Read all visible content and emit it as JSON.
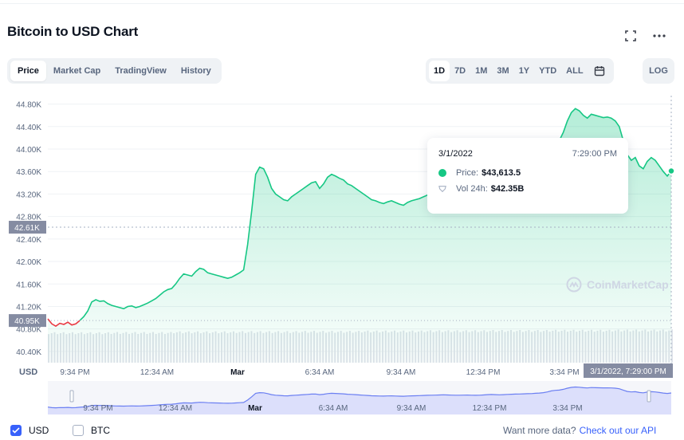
{
  "header": {
    "title": "Bitcoin to USD Chart",
    "fullscreen_icon": "fullscreen-icon",
    "more_icon": "more-horizontal-icon"
  },
  "tabs": [
    {
      "label": "Price",
      "active": true
    },
    {
      "label": "Market Cap",
      "active": false
    },
    {
      "label": "TradingView",
      "active": false
    },
    {
      "label": "History",
      "active": false
    }
  ],
  "ranges": [
    {
      "label": "1D",
      "active": true
    },
    {
      "label": "7D",
      "active": false
    },
    {
      "label": "1M",
      "active": false
    },
    {
      "label": "3M",
      "active": false
    },
    {
      "label": "1Y",
      "active": false
    },
    {
      "label": "YTD",
      "active": false
    },
    {
      "label": "ALL",
      "active": false
    }
  ],
  "log_label": "LOG",
  "tooltip": {
    "date": "3/1/2022",
    "time": "7:29:00 PM",
    "price_label": "Price:",
    "price_value": "$43,613.5",
    "vol_label": "Vol 24h:",
    "vol_value": "$42.35B"
  },
  "watermark": "CoinMarketCap",
  "chart_data": {
    "type": "line",
    "y_ticks": [
      "44.80K",
      "44.40K",
      "44.00K",
      "43.60K",
      "43.20K",
      "42.80K",
      "42.40K",
      "42.00K",
      "41.60K",
      "41.20K",
      "40.80K",
      "40.40K"
    ],
    "y_tick_values": [
      44800,
      44400,
      44000,
      43600,
      43200,
      42800,
      42400,
      42000,
      41600,
      41200,
      40800,
      40400
    ],
    "ylim": [
      40200,
      44950
    ],
    "y_axis_unit": "USD",
    "x_ticks": [
      "9:34 PM",
      "12:34 AM",
      "Mar",
      "6:34 AM",
      "9:34 AM",
      "12:34 PM",
      "3:34 PM"
    ],
    "x_tick_positions_fraction": [
      0.0,
      0.12
    ],
    "crosshair_y_label": "42.61K",
    "crosshair_y_value": 42610,
    "open_label": "40.95K",
    "open_value": 40950,
    "crosshair_x_label": "3/1/2022, 7:29:00 PM",
    "price": [
      40980,
      40890,
      40850,
      40900,
      40880,
      40920,
      40870,
      40890,
      40950,
      41020,
      41120,
      41280,
      41320,
      41290,
      41300,
      41250,
      41220,
      41200,
      41180,
      41160,
      41200,
      41210,
      41180,
      41200,
      41230,
      41260,
      41300,
      41340,
      41400,
      41460,
      41500,
      41520,
      41600,
      41700,
      41780,
      41760,
      41740,
      41820,
      41880,
      41860,
      41800,
      41780,
      41760,
      41740,
      41720,
      41700,
      41720,
      41760,
      41800,
      41850,
      42300,
      42900,
      43550,
      43680,
      43650,
      43500,
      43300,
      43200,
      43150,
      43100,
      43080,
      43150,
      43200,
      43250,
      43300,
      43350,
      43400,
      43420,
      43300,
      43380,
      43500,
      43550,
      43520,
      43480,
      43450,
      43380,
      43350,
      43300,
      43250,
      43200,
      43150,
      43100,
      43080,
      43050,
      43030,
      43060,
      43080,
      43050,
      43020,
      43000,
      43050,
      43080,
      43100,
      43120,
      43150,
      43180,
      43200,
      43220,
      43250,
      43280,
      43250,
      43220,
      43200,
      43200,
      43220,
      43230,
      43200,
      43180,
      43200,
      43250,
      43300,
      43330,
      43300,
      43280,
      43300,
      43350,
      43380,
      43400,
      43420,
      43450,
      43480,
      43500,
      43550,
      43600,
      43680,
      43800,
      44000,
      44100,
      44150,
      44300,
      44500,
      44650,
      44720,
      44680,
      44600,
      44550,
      44620,
      44600,
      44580,
      44560,
      44570,
      44550,
      44500,
      44400,
      44150,
      43900,
      43800,
      43850,
      43700,
      43650,
      43780,
      43850,
      43800,
      43700,
      43600,
      43520,
      43610
    ],
    "volume_relative": [
      0.7,
      0.72,
      0.78,
      0.8,
      0.82,
      0.85,
      0.88,
      0.9,
      0.92,
      0.94,
      0.96
    ]
  },
  "navigator": {
    "x_ticks": [
      "9:34 PM",
      "12:34 AM",
      "Mar",
      "6:34 AM",
      "9:34 AM",
      "12:34 PM",
      "3:34 PM"
    ]
  },
  "footer": {
    "usd_label": "USD",
    "btc_label": "BTC",
    "api_text": "Want more data?",
    "api_link": "Check out our API"
  }
}
